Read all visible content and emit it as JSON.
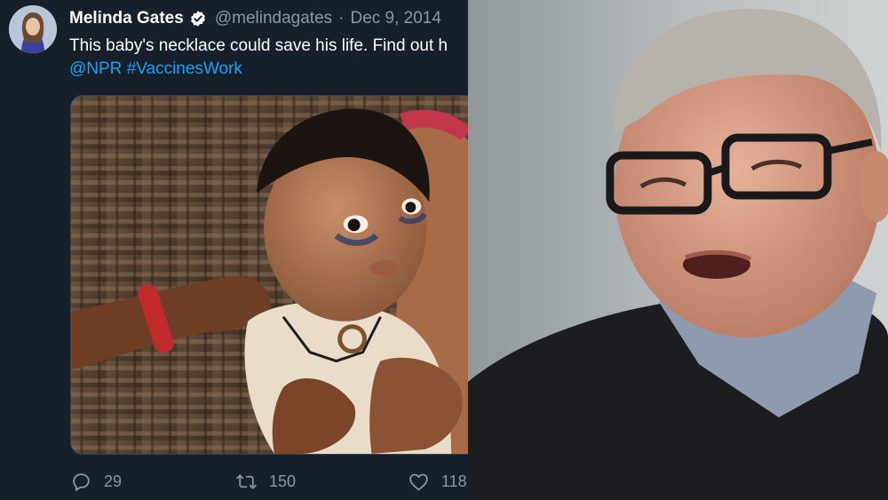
{
  "tweet": {
    "author_name": "Melinda Gates",
    "handle": "@melindagates",
    "separator": "·",
    "date": "Dec 9, 2014",
    "text": "This baby's necklace could save his life. Find out h",
    "mention": "@NPR",
    "hashtag": "#VaccinesWork",
    "actions": {
      "replies": "29",
      "retweets": "150",
      "likes": "118"
    }
  },
  "colors": {
    "background": "#15202b",
    "text_primary": "#ffffff",
    "text_secondary": "#8899a6",
    "link": "#1da1f2"
  },
  "icons": [
    "verified-badge-icon",
    "reply-icon",
    "retweet-icon",
    "like-icon"
  ]
}
